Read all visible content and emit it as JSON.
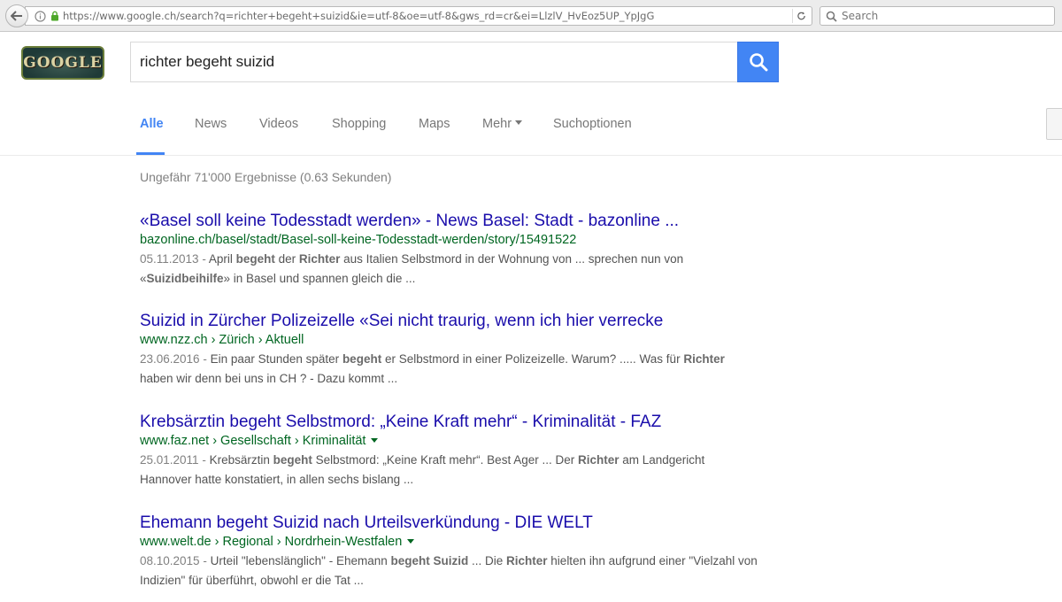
{
  "browser": {
    "url": "https://www.google.ch/search?q=richter+begeht+suizid&ie=utf-8&oe=utf-8&gws_rd=cr&ei=LlzlV_HvEoz5UP_YpJgG",
    "search_placeholder": "Search"
  },
  "header": {
    "doodle_text": "GOOGLE",
    "query": "richter begeht suizid"
  },
  "tabs": [
    {
      "label": "Alle"
    },
    {
      "label": "News"
    },
    {
      "label": "Videos"
    },
    {
      "label": "Shopping"
    },
    {
      "label": "Maps"
    },
    {
      "label": "Mehr"
    },
    {
      "label": "Suchoptionen"
    }
  ],
  "stats": "Ungefähr 71'000 Ergebnisse (0.63 Sekunden)",
  "results": [
    {
      "title": "«Basel soll keine Todesstadt werden» - News Basel: Stadt - bazonline ...",
      "url": "bazonline.ch/basel/stadt/Basel-soll-keine-Todesstadt-werden/story/15491522",
      "date": "05.11.2013 - ",
      "s1": "April ",
      "b1": "begeht",
      "s2": " der ",
      "b2": "Richter",
      "s3": " aus Italien Selbstmord in der Wohnung von ... sprechen nun von «",
      "b3": "Suizidbeihilfe",
      "s4": "» in Basel und spannen gleich die ..."
    },
    {
      "title": "Suizid in Zürcher Polizeizelle «Sei nicht traurig, wenn ich hier verrecke",
      "url": "www.nzz.ch › Zürich › Aktuell",
      "date": "23.06.2016 - ",
      "s1": "Ein paar Stunden später ",
      "b1": "begeht",
      "s2": " er Selbstmord in einer Polizeizelle. Warum? ..... Was für ",
      "b2": "Richter",
      "s3": " haben wir denn bei uns in CH ? - Dazu kommt ..."
    },
    {
      "title": "Krebsärztin begeht Selbstmord: „Keine Kraft mehr“ - Kriminalität - FAZ",
      "url": "www.faz.net › Gesellschaft › Kriminalität",
      "date": "25.01.2011 - ",
      "s1": "Krebsärztin ",
      "b1": "begeht",
      "s2": " Selbstmord: „Keine Kraft mehr“. Best Ager ... Der ",
      "b2": "Richter",
      "s3": " am Landgericht Hannover hatte konstatiert, in allen sechs bislang ..."
    },
    {
      "title": "Ehemann begeht Suizid nach Urteilsverkündung - DIE WELT",
      "url": "www.welt.de › Regional › Nordrhein-Westfalen",
      "date": "08.10.2015 - ",
      "s1": "Urteil \"lebenslänglich\" - Ehemann ",
      "b1": "begeht Suizid",
      "s2": " ... Die ",
      "b2": "Richter",
      "s3": " hielten ihn aufgrund einer \"Vielzahl von Indizien\" für überführt, obwohl er die Tat ..."
    }
  ]
}
